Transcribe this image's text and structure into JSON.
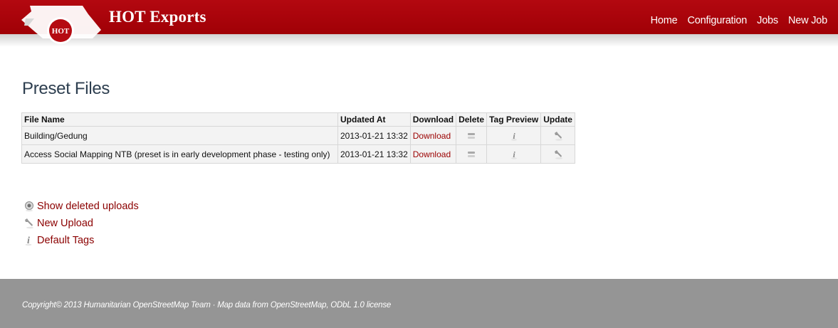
{
  "header": {
    "logo_text": "HOT",
    "brand": "HOT Exports",
    "nav": [
      "Home",
      "Configuration",
      "Jobs",
      "New Job"
    ]
  },
  "page": {
    "title": "Preset Files"
  },
  "table": {
    "columns": [
      "File Name",
      "Updated At",
      "Download",
      "Delete",
      "Tag Preview",
      "Update"
    ],
    "rows": [
      {
        "name": "Building/Gedung",
        "updated": "2013-01-21 13:32",
        "download": "Download"
      },
      {
        "name": "Access Social Mapping NTB (preset is in early development phase - testing only)",
        "updated": "2013-01-21 13:32",
        "download": "Download"
      }
    ],
    "icons": {
      "delete": "delete-icon",
      "tag_preview": "info-icon",
      "update": "wrench-icon"
    }
  },
  "actions": [
    {
      "label": "Show deleted uploads",
      "icon": "eye-icon"
    },
    {
      "label": "New Upload",
      "icon": "wrench-icon"
    },
    {
      "label": "Default Tags",
      "icon": "info-icon"
    }
  ],
  "footer": {
    "text": "Copyright© 2013 Humanitarian OpenStreetMap Team · Map data from OpenStreetMap, ODbL 1.0 license"
  },
  "colors": {
    "header": "#a80008",
    "link": "#8b0000",
    "footer": "#959595"
  }
}
